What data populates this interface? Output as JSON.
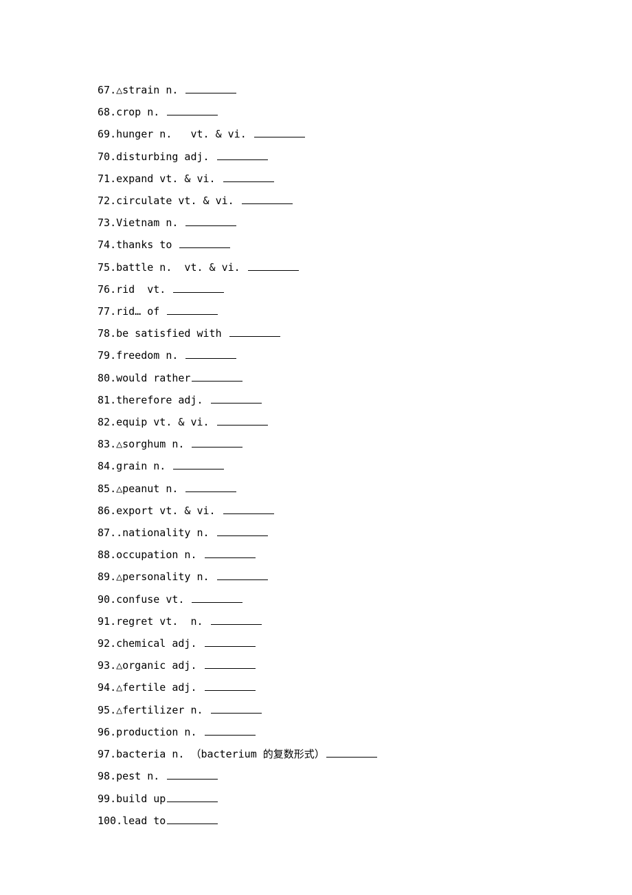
{
  "items": [
    {
      "num": "67",
      "text": "△strain n. "
    },
    {
      "num": "68",
      "text": "crop n. "
    },
    {
      "num": "69",
      "text": "hunger n.   vt. & vi. "
    },
    {
      "num": "70",
      "text": "disturbing adj. "
    },
    {
      "num": "71",
      "text": "expand vt. & vi. "
    },
    {
      "num": "72",
      "text": "circulate vt. & vi. "
    },
    {
      "num": "73",
      "text": "Vietnam n. "
    },
    {
      "num": "74",
      "text": "thanks to "
    },
    {
      "num": "75",
      "text": "battle n.  vt. & vi. "
    },
    {
      "num": "76",
      "text": "rid  vt. "
    },
    {
      "num": "77",
      "text": "rid… of "
    },
    {
      "num": "78",
      "text": "be satisfied with "
    },
    {
      "num": "79",
      "text": "freedom n. "
    },
    {
      "num": "80",
      "text": "would rather"
    },
    {
      "num": "81",
      "text": "therefore adj. "
    },
    {
      "num": "82",
      "text": "equip vt. & vi. "
    },
    {
      "num": "83",
      "text": "△sorghum n. "
    },
    {
      "num": "84",
      "text": "grain n. "
    },
    {
      "num": "85",
      "text": "△peanut n. "
    },
    {
      "num": "86",
      "text": "export vt. & vi. "
    },
    {
      "num": "87",
      "text": ".nationality n. "
    },
    {
      "num": "88",
      "text": "occupation n. "
    },
    {
      "num": "89",
      "text": "△personality n. "
    },
    {
      "num": "90",
      "text": "confuse vt. "
    },
    {
      "num": "91",
      "text": "regret vt.  n. "
    },
    {
      "num": "92",
      "text": "chemical adj. "
    },
    {
      "num": "93",
      "text": "△organic adj. "
    },
    {
      "num": "94",
      "text": "△fertile adj. "
    },
    {
      "num": "95",
      "text": "△fertilizer n. "
    },
    {
      "num": "96",
      "text": "production n. "
    },
    {
      "num": "97",
      "text": "bacteria n. （bacterium 的复数形式）"
    },
    {
      "num": "98",
      "text": "pest n. "
    },
    {
      "num": "99",
      "text": "build up"
    },
    {
      "num": "100",
      "text": "lead to"
    }
  ]
}
